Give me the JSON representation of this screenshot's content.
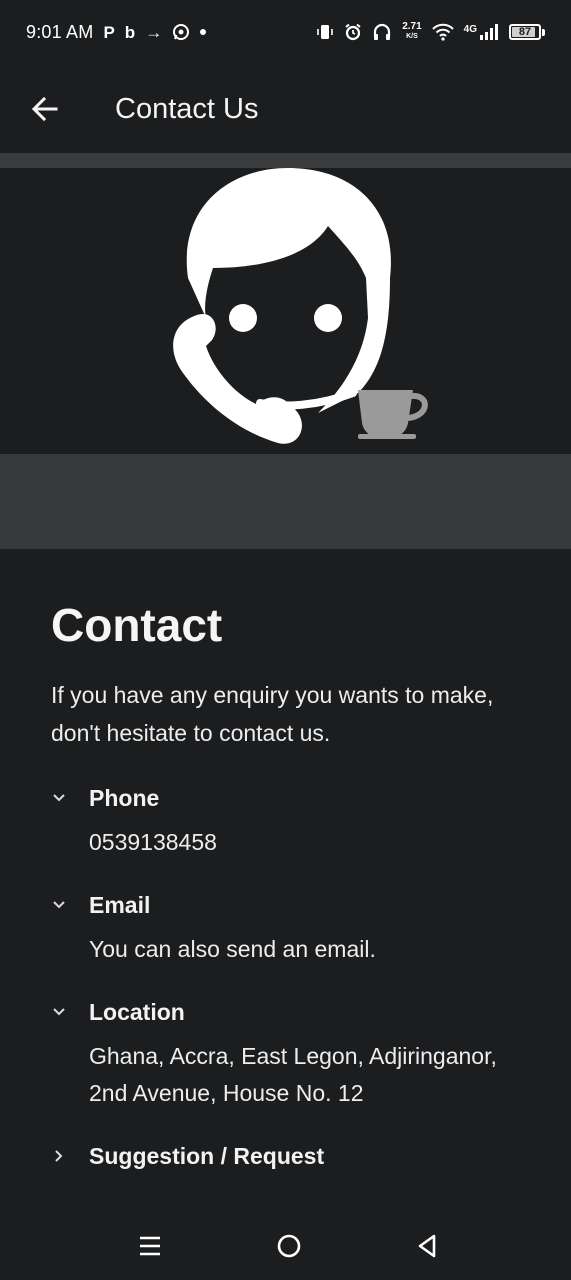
{
  "status_bar": {
    "time": "9:01 AM",
    "left_glyphs": [
      "P",
      "b",
      "→"
    ],
    "net_speed_value": "2.71",
    "net_speed_unit": "K/S",
    "network_label": "4G",
    "battery_level": "87"
  },
  "app_bar": {
    "title": "Contact Us"
  },
  "content": {
    "heading": "Contact",
    "intro": "If you have any enquiry you wants to make, don't hesitate to contact us."
  },
  "accordion": [
    {
      "title": "Phone",
      "body": "0539138458",
      "expanded": true
    },
    {
      "title": "Email",
      "body": "You can also send an email.",
      "expanded": true
    },
    {
      "title": "Location",
      "body": "Ghana, Accra, East Legon, Adjiringanor, 2nd Avenue, House No. 12",
      "expanded": true
    },
    {
      "title": "Suggestion / Request",
      "body": "",
      "expanded": false
    }
  ],
  "colors": {
    "background": "#1c1d1f",
    "banner_band": "#38393b",
    "text": "#f2f2f2",
    "cup": "#9a9a9a"
  },
  "icons": {
    "back": "arrow-left-icon",
    "support": "customer-support-icon",
    "cup": "coffee-cup-icon",
    "expanded": "chevron-down-icon",
    "collapsed": "chevron-right-icon",
    "nav_menu": "menu-lines-icon",
    "nav_home": "home-circle-icon",
    "nav_back": "back-triangle-icon"
  }
}
